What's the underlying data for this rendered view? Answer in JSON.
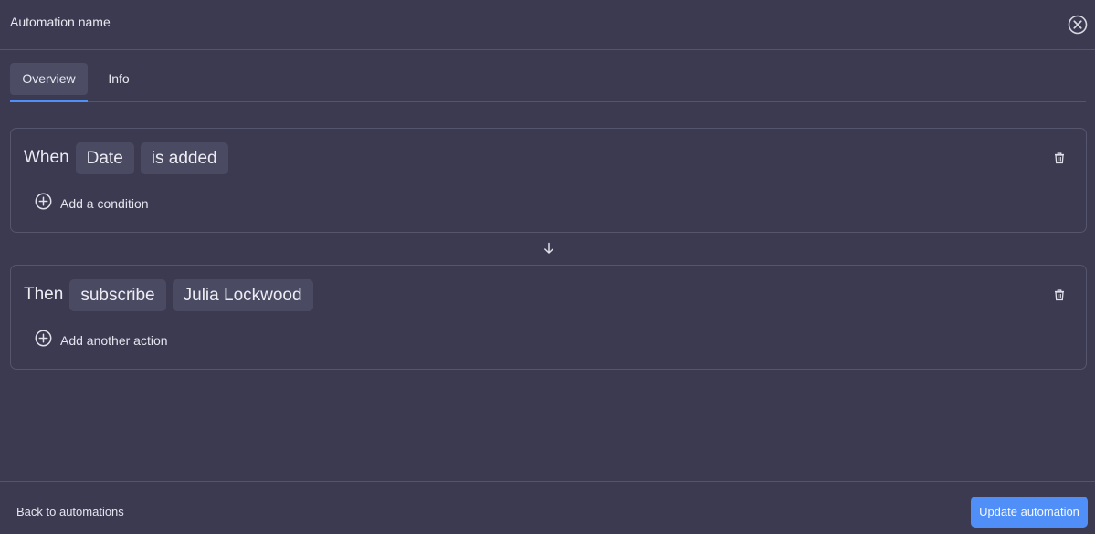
{
  "header": {
    "title": "Automation name",
    "close_icon": "close-circle-icon"
  },
  "tabs": [
    {
      "label": "Overview",
      "active": true
    },
    {
      "label": "Info",
      "active": false
    }
  ],
  "trigger": {
    "keyword": "When",
    "chips": [
      "Date",
      "is added"
    ],
    "add_label": "Add a condition"
  },
  "action": {
    "keyword": "Then",
    "chips": [
      "subscribe",
      "Julia Lockwood"
    ],
    "add_label": "Add another action"
  },
  "footer": {
    "back_label": "Back to automations",
    "update_label": "Update automation"
  },
  "colors": {
    "background": "#3b3a50",
    "chip": "#4b4a63",
    "accent": "#4f8ff7",
    "border": "#55546c"
  }
}
